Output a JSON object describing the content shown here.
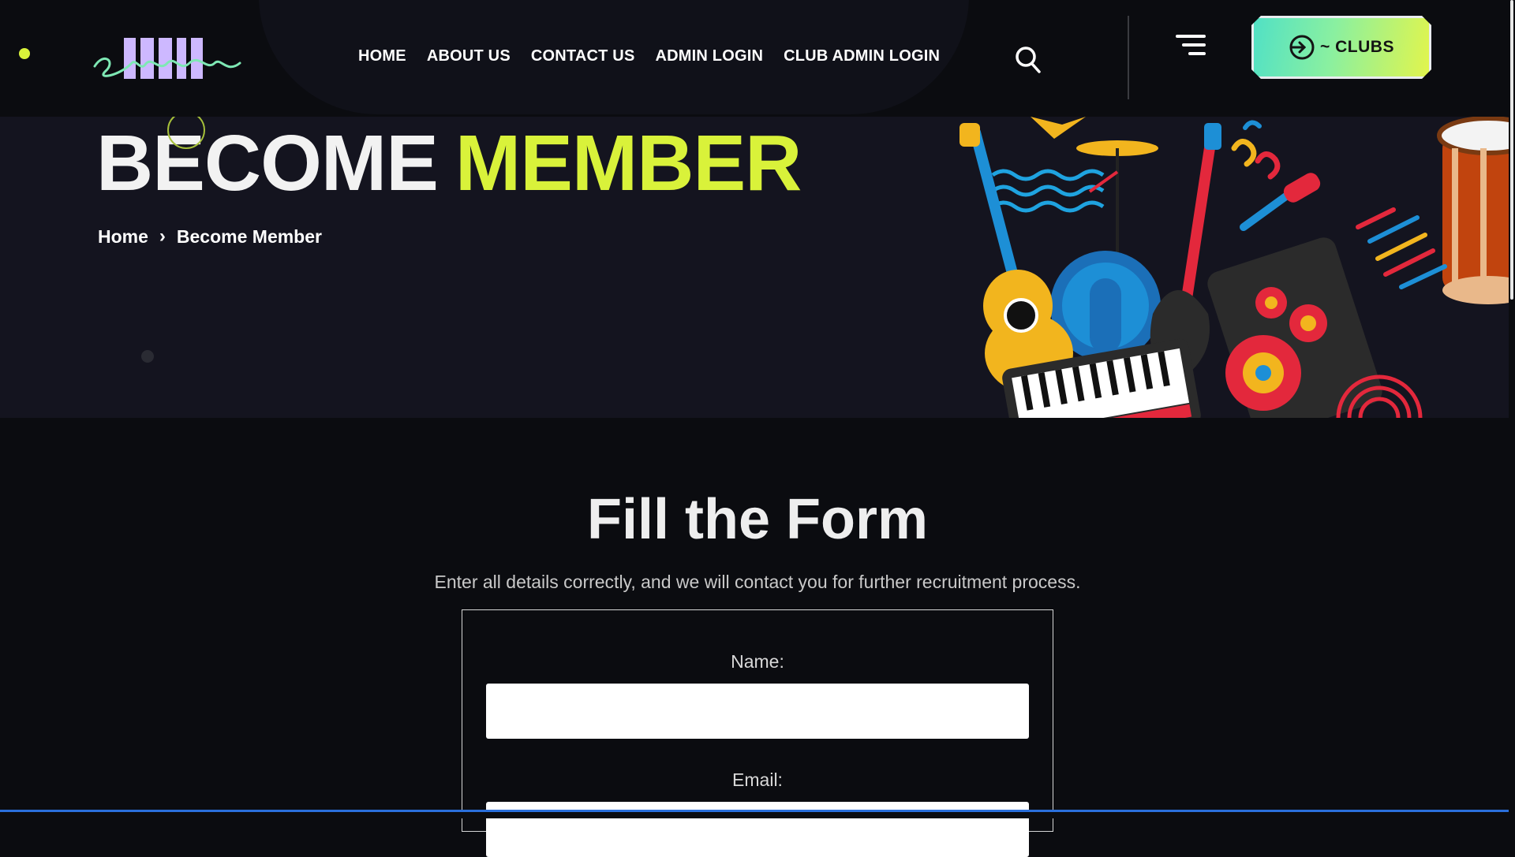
{
  "header": {
    "nav": [
      "HOME",
      "ABOUT US",
      "CONTACT US",
      "ADMIN LOGIN",
      "CLUB ADMIN LOGIN"
    ],
    "clubs_button": "~ CLUBS",
    "icons": {
      "search": "search-icon",
      "menu": "hamburger-menu-icon",
      "login": "login-arrow-icon"
    }
  },
  "hero": {
    "title_part1": "BECOME",
    "title_part2": "MEMBER",
    "breadcrumb": {
      "home": "Home",
      "current": "Become Member"
    }
  },
  "form": {
    "title": "Fill the Form",
    "subtitle": "Enter all details correctly, and we will contact you for further recruitment process.",
    "fields": [
      {
        "label": "Name:",
        "value": ""
      },
      {
        "label": "Email:",
        "value": ""
      }
    ]
  },
  "colors": {
    "accent": "#d9f23a",
    "background": "#0b0c10",
    "hero_bg": "#14141f"
  }
}
